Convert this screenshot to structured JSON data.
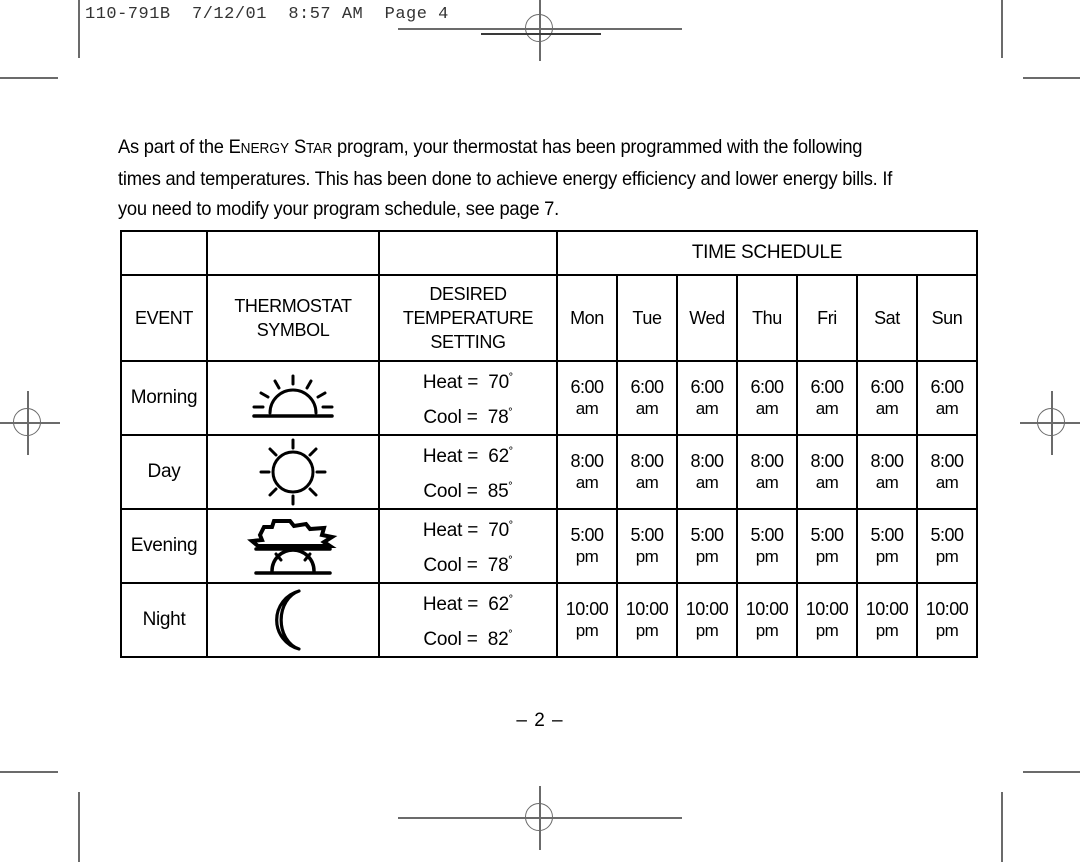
{
  "slug": {
    "text": "110-791B  7/12/01  8:57 AM  Page 4"
  },
  "paragraph": {
    "part1": "As part of the ",
    "energy_e": "E",
    "energy_rest": "NERGY",
    "star_s": "S",
    "star_rest": "TAR",
    "part2": " program, your thermostat has been programmed with the following times and temperatures. This has been done to achieve energy efficiency and lower energy bills. If you need to modify your program schedule, see page 7."
  },
  "table": {
    "time_schedule_header": "TIME SCHEDULE",
    "headers": {
      "event": "EVENT",
      "symbol_line1": "THERMOSTAT",
      "symbol_line2": "SYMBOL",
      "temp_line1": "DESIRED",
      "temp_line2": "TEMPERATURE",
      "temp_line3": "SETTING"
    },
    "days": [
      "Mon",
      "Tue",
      "Wed",
      "Thu",
      "Fri",
      "Sat",
      "Sun"
    ],
    "rows": [
      {
        "event": "Morning",
        "symbol": "sunrise-icon",
        "heat_label": "Heat =",
        "heat_value": "70",
        "cool_label": "Cool =",
        "cool_value": "78",
        "degree": "˚",
        "time": "6:00",
        "ampm": "am"
      },
      {
        "event": "Day",
        "symbol": "sun-icon",
        "heat_label": "Heat =",
        "heat_value": "62",
        "cool_label": "Cool =",
        "cool_value": "85",
        "degree": "˚",
        "time": "8:00",
        "ampm": "am"
      },
      {
        "event": "Evening",
        "symbol": "sunset-cloud-icon",
        "heat_label": "Heat =",
        "heat_value": "70",
        "cool_label": "Cool =",
        "cool_value": "78",
        "degree": "˚",
        "time": "5:00",
        "ampm": "pm"
      },
      {
        "event": "Night",
        "symbol": "moon-icon",
        "heat_label": "Heat =",
        "heat_value": "62",
        "cool_label": "Cool =",
        "cool_value": "82",
        "degree": "˚",
        "time": "10:00",
        "ampm": "pm"
      }
    ]
  },
  "footer": {
    "folio": "– 2 –"
  },
  "colors": {
    "text": "#000000",
    "rule": "#6b6b6b",
    "page_background": "#ffffff"
  }
}
